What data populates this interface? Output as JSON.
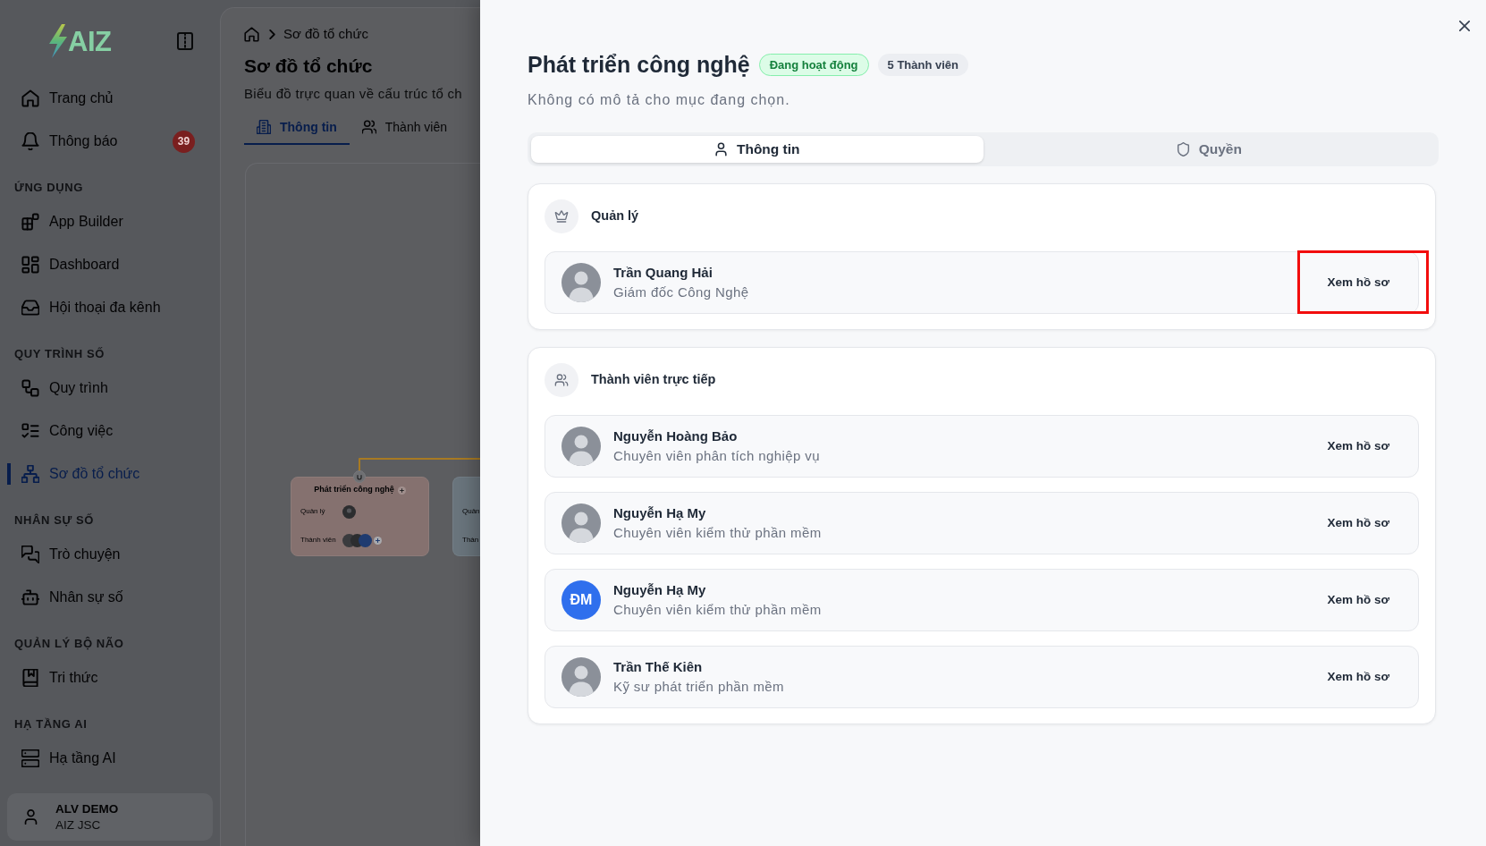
{
  "sidebar": {
    "logo": {
      "text": "AIZ"
    },
    "sections": [
      {
        "items": [
          {
            "label": "Trang chủ",
            "selected": false
          },
          {
            "label": "Thông báo",
            "selected": false,
            "badge": "39"
          }
        ]
      },
      {
        "title": "ỨNG DỤNG",
        "items": [
          {
            "label": "App Builder",
            "selected": false
          },
          {
            "label": "Dashboard",
            "selected": false
          },
          {
            "label": "Hội thoại đa kênh",
            "selected": false
          }
        ]
      },
      {
        "title": "QUY TRÌNH SỐ",
        "items": [
          {
            "label": "Quy trình",
            "selected": false
          },
          {
            "label": "Công việc",
            "selected": false
          },
          {
            "label": "Sơ đồ tổ chức",
            "selected": true
          }
        ]
      },
      {
        "title": "NHÂN SỰ SỐ",
        "items": [
          {
            "label": "Trò chuyện",
            "selected": false
          },
          {
            "label": "Nhân sự số",
            "selected": false
          }
        ]
      },
      {
        "title": "QUẢN LÝ BỘ NÃO",
        "items": [
          {
            "label": "Tri thức",
            "selected": false
          }
        ]
      },
      {
        "title": "HẠ TẦNG AI",
        "items": [
          {
            "label": "Hạ tầng AI",
            "selected": false
          }
        ]
      }
    ],
    "user": {
      "name": "ALV DEMO",
      "organization": "AIZ JSC"
    }
  },
  "main": {
    "breadcrumb": {
      "current": "Sơ đồ tổ chức"
    },
    "title": "Sơ đồ tổ chức",
    "description": "Biểu đồ trực quan về cấu trúc tổ ch",
    "tabs": [
      {
        "label": "Thông tin",
        "selected": true
      },
      {
        "label": "Thành viên",
        "selected": false
      }
    ],
    "org_chart": {
      "nodes": [
        {
          "title": "Phát triển công nghệ",
          "manager_label": "Quản lý",
          "members_label": "Thành viên",
          "color": "#85716f"
        },
        {
          "manager_label": "Quản",
          "members_label": "Thàn",
          "color": "#6a757d"
        }
      ]
    }
  },
  "drawer": {
    "title": "Phát triển công nghệ",
    "status": "Đang hoạt động",
    "member_count": "5 Thành viên",
    "description": "Không có mô tả cho mục đang chọn.",
    "tabs": [
      {
        "label": "Thông tin",
        "selected": true
      },
      {
        "label": "Quyền",
        "selected": false
      }
    ],
    "manager_section": {
      "title": "Quản lý",
      "people": [
        {
          "name": "Trần Quang Hải",
          "role": "Giám đốc Công Nghệ",
          "avatar": {
            "kind": "photo"
          },
          "action": "Xem hồ sơ",
          "highlighted": true
        }
      ]
    },
    "members_section": {
      "title": "Thành viên trực tiếp",
      "people": [
        {
          "name": "Nguyễn Hoàng Bảo",
          "role": "Chuyên viên phân tích nghiệp vụ",
          "avatar": {
            "kind": "photo"
          },
          "action": "Xem hồ sơ",
          "highlighted": false
        },
        {
          "name": "Nguyễn Hạ My",
          "role": "Chuyên viên kiểm thử phần mềm",
          "avatar": {
            "kind": "photo"
          },
          "action": "Xem hồ sơ",
          "highlighted": false
        },
        {
          "name": "Nguyễn Hạ My",
          "role": "Chuyên viên kiểm thử phần mềm",
          "avatar": {
            "kind": "initials",
            "text": "ĐM"
          },
          "action": "Xem hồ sơ",
          "highlighted": false
        },
        {
          "name": "Trần Thế Kiên",
          "role": "Kỹ sư phát triển phần mềm",
          "avatar": {
            "kind": "photo"
          },
          "action": "Xem hồ sơ",
          "highlighted": false
        }
      ]
    }
  }
}
